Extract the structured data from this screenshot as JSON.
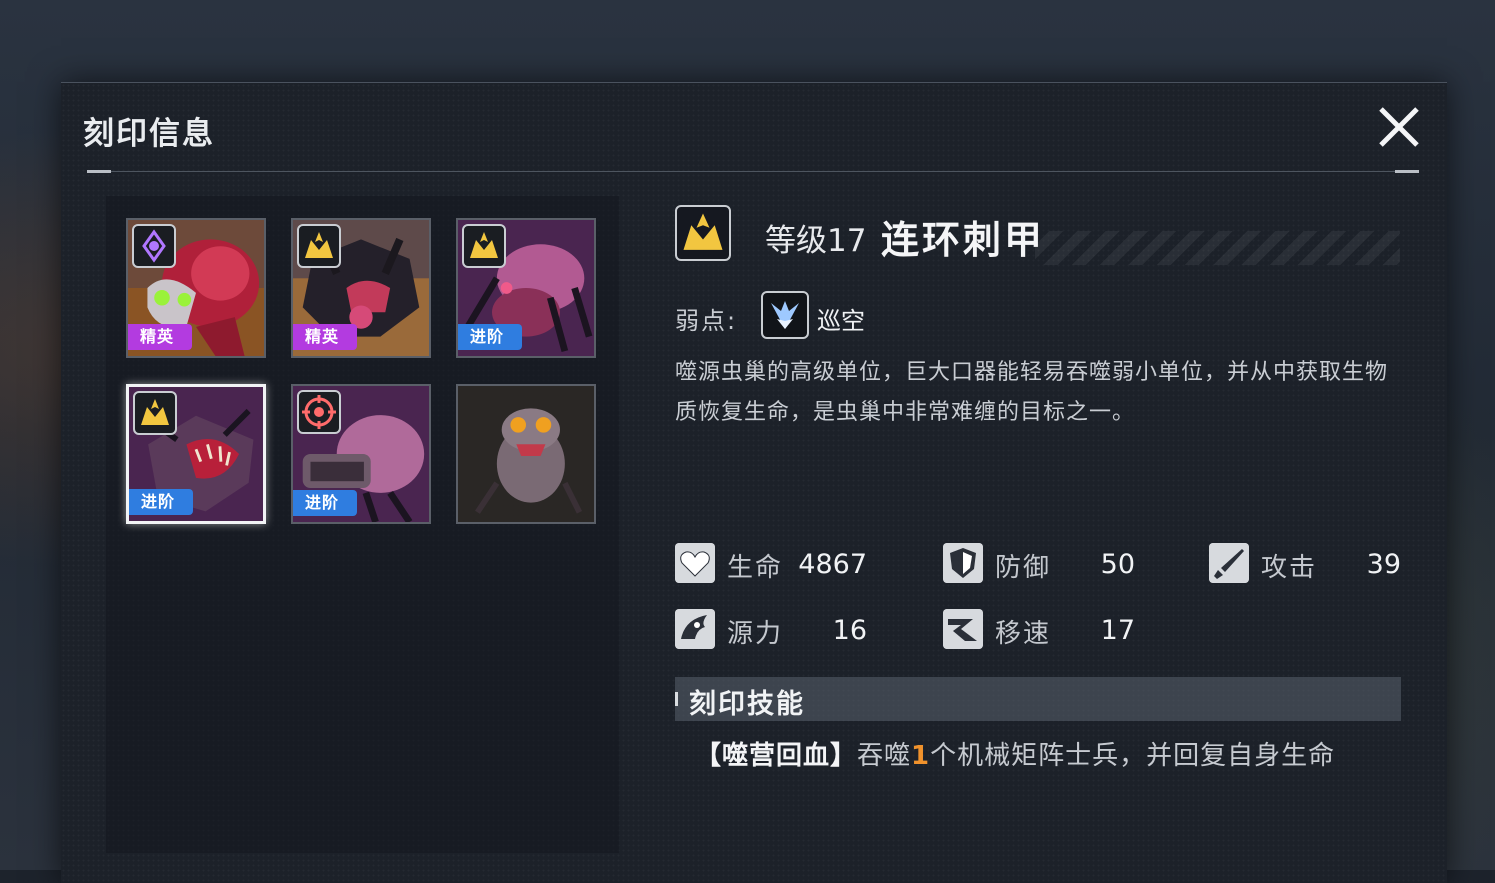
{
  "panel": {
    "title": "刻印信息"
  },
  "cards": [
    {
      "tag": "精英",
      "tag_type": "elite",
      "badge": "purple-rank-icon",
      "art": "flesh-brain-bug"
    },
    {
      "tag": "精英",
      "tag_type": "elite",
      "badge": "gold-rank-icon",
      "art": "dark-spiked-bug"
    },
    {
      "tag": "进阶",
      "tag_type": "adv",
      "badge": "gold-rank-icon",
      "art": "pink-crab-bug"
    },
    {
      "tag": "进阶",
      "tag_type": "adv",
      "badge": "gold-rank-icon",
      "art": "maw-spider-bug",
      "selected": true
    },
    {
      "tag": "进阶",
      "tag_type": "adv",
      "badge": "red-target-icon",
      "art": "cannon-bug"
    },
    {
      "tag": "",
      "tag_type": "none",
      "badge": "",
      "art": "small-spiky-bug"
    }
  ],
  "unit": {
    "level": "等级17",
    "name": "连环刺甲",
    "weak_label": "弱点:",
    "weak_value": "巡空",
    "description": "噬源虫巢的高级单位，巨大口器能轻易吞噬弱小单位，并从中获取生物质恢复生命，是虫巢中非常难缠的目标之一。"
  },
  "stats": [
    {
      "label": "生命",
      "value": "4867",
      "icon": "heart-icon"
    },
    {
      "label": "防御",
      "value": "50",
      "icon": "shield-icon"
    },
    {
      "label": "攻击",
      "value": "39",
      "icon": "sword-icon"
    },
    {
      "label": "源力",
      "value": "16",
      "icon": "power-icon"
    },
    {
      "label": "移速",
      "value": "17",
      "icon": "speed-icon"
    }
  ],
  "skill": {
    "section_title": "刻印技能",
    "name": "【噬营回血】",
    "text_before": "吞噬",
    "number": "1",
    "text_after": "个机械矩阵士兵，并回复自身生命"
  },
  "colors": {
    "elite_tag": "#b33be0",
    "advanced_tag": "#2f7de0",
    "highlight_number": "#f0922c",
    "gold_badge": "#f2c640"
  }
}
